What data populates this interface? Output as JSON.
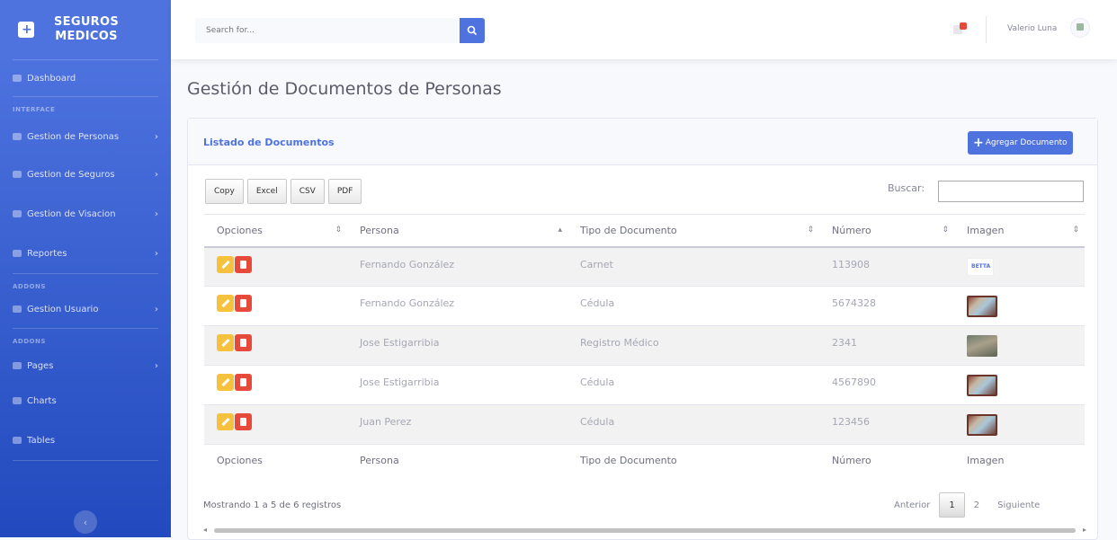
{
  "brand": {
    "line1": "SEGUROS",
    "line2": "MEDICOS"
  },
  "sidebar": {
    "dashboard": "Dashboard",
    "heading_interface": "INTERFACE",
    "items_interface": [
      {
        "label": "Gestion de Personas",
        "icon": "users-icon"
      },
      {
        "label": "Gestion de Seguros",
        "icon": "file-icon"
      },
      {
        "label": "Gestion de Visacion",
        "icon": "car-icon"
      },
      {
        "label": "Reportes",
        "icon": "report-icon"
      }
    ],
    "heading_addons1": "ADDONS",
    "item_usuario": "Gestion Usuario",
    "heading_addons2": "ADDONS",
    "item_pages": "Pages",
    "item_charts": "Charts",
    "item_tables": "Tables"
  },
  "topbar": {
    "search_placeholder": "Search for...",
    "user_name": "Valerio Luna"
  },
  "page": {
    "title": "Gestión de Documentos de Personas"
  },
  "card": {
    "title": "Listado de Documentos",
    "add_button": "Agregar Documento",
    "export_buttons": [
      "Copy",
      "Excel",
      "CSV",
      "PDF"
    ],
    "search_label": "Buscar:"
  },
  "table": {
    "headers": [
      "Opciones",
      "Persona",
      "Tipo de Documento",
      "Número",
      "Imagen"
    ],
    "rows": [
      {
        "persona": "Fernando González",
        "tipo": "Carnet",
        "numero": "113908",
        "imagen": "logo"
      },
      {
        "persona": "Fernando González",
        "tipo": "Cédula",
        "numero": "5674328",
        "imagen": "id-card"
      },
      {
        "persona": "Jose Estigarribia",
        "tipo": "Registro Médico",
        "numero": "2341",
        "imagen": "photo"
      },
      {
        "persona": "Jose Estigarribia",
        "tipo": "Cédula",
        "numero": "4567890",
        "imagen": "id-card"
      },
      {
        "persona": "Juan Perez",
        "tipo": "Cédula",
        "numero": "123456",
        "imagen": "id-card"
      }
    ],
    "logo_text": "BETTA"
  },
  "footer": {
    "info": "Mostrando 1 a 5 de 6 registros",
    "prev": "Anterior",
    "pages": [
      "1",
      "2"
    ],
    "next": "Siguiente"
  }
}
